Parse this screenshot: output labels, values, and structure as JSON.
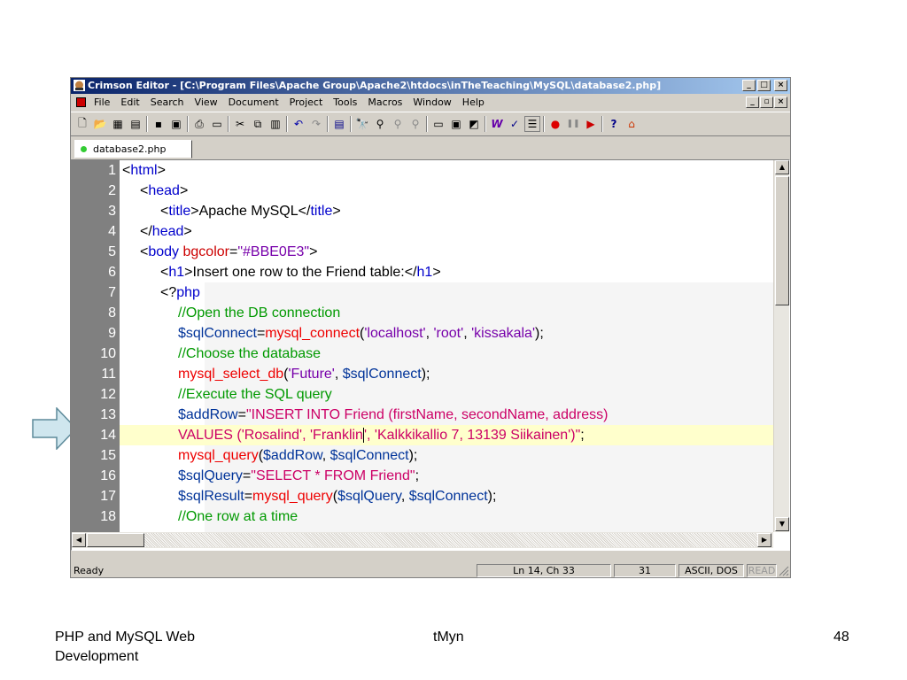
{
  "window": {
    "title": "Crimson Editor - [C:\\Program Files\\Apache Group\\Apache2\\htdocs\\inTheTeaching\\MySQL\\database2.php]",
    "controls": [
      "_",
      "□",
      "×"
    ],
    "mdi_controls": [
      "_",
      "▫",
      "×"
    ]
  },
  "menu": [
    "File",
    "Edit",
    "Search",
    "View",
    "Document",
    "Project",
    "Tools",
    "Macros",
    "Window",
    "Help"
  ],
  "toolbar_icons": [
    "new-file-icon",
    "open-folder-icon",
    "open-project-icon",
    "open-remote-icon",
    "save-icon",
    "save-all-icon",
    "print-icon",
    "print-preview-icon",
    "cut-icon",
    "copy-icon",
    "paste-icon",
    "undo-icon",
    "redo-icon",
    "column-mode-icon",
    "find-icon",
    "find-next-icon",
    "replace-icon",
    "goto-icon",
    "toggle-output-icon",
    "directory-tree-icon",
    "command-icon",
    "word-wrap-icon",
    "spell-check-icon",
    "line-numbers-icon",
    "record-macro-icon",
    "pause-macro-icon",
    "play-macro-icon",
    "help-icon",
    "home-icon"
  ],
  "tab": {
    "label": "database2.php"
  },
  "editor": {
    "current_line": 14,
    "lines": [
      {
        "n": "1"
      },
      {
        "n": "2"
      },
      {
        "n": "3"
      },
      {
        "n": "4"
      },
      {
        "n": "5"
      },
      {
        "n": "6"
      },
      {
        "n": "7"
      },
      {
        "n": "8"
      },
      {
        "n": "9"
      },
      {
        "n": "10"
      },
      {
        "n": "11"
      },
      {
        "n": "12"
      },
      {
        "n": "13"
      },
      {
        "n": "14"
      },
      {
        "n": "15"
      },
      {
        "n": "16"
      },
      {
        "n": "17"
      },
      {
        "n": "18"
      }
    ]
  },
  "status": {
    "ready": "Ready",
    "position": "Ln 14, Ch 33",
    "column": "31",
    "encoding": "ASCII, DOS",
    "mode": "READ"
  },
  "footer": {
    "left_line1": "PHP and MySQL Web",
    "left_line2": "Development",
    "center": "tMyn",
    "page": "48"
  },
  "colors": {
    "title_gradient_start": "#0a246a",
    "title_gradient_end": "#a6caf0",
    "gutter": "#808080",
    "current_line_bg": "#ffffcc",
    "arrow_fill": "#cfe6ee"
  }
}
